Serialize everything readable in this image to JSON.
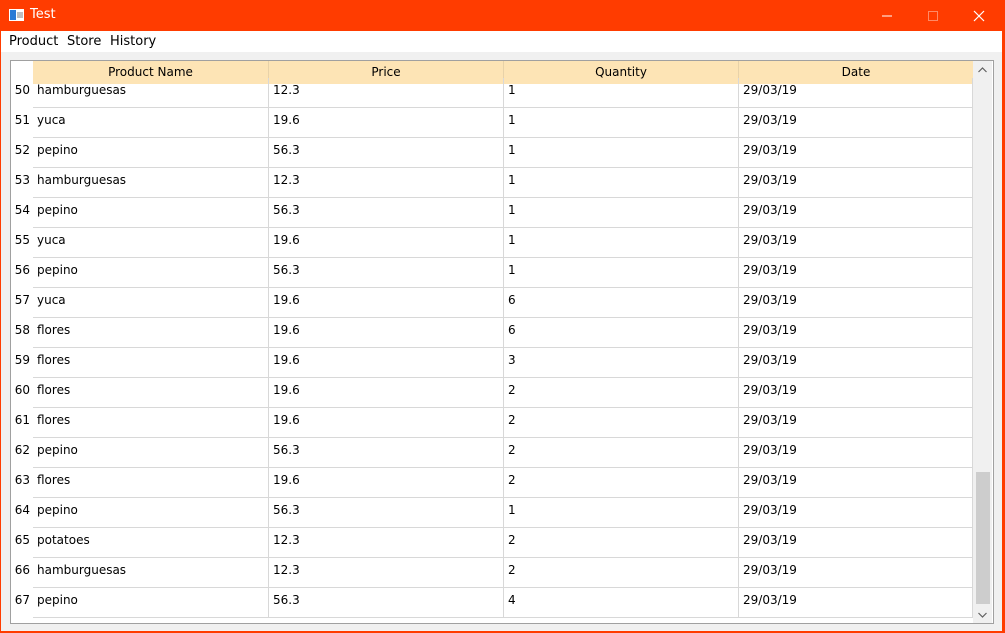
{
  "window": {
    "title": "Test"
  },
  "menu": {
    "items": [
      "Product",
      "Store",
      "History"
    ]
  },
  "table": {
    "columns": [
      "Product Name",
      "Price",
      "Quantity",
      "Date"
    ],
    "rows": [
      {
        "index": "50",
        "cells": [
          "hamburguesas",
          "12.3",
          "1",
          "29/03/19"
        ]
      },
      {
        "index": "51",
        "cells": [
          "yuca",
          "19.6",
          "1",
          "29/03/19"
        ]
      },
      {
        "index": "52",
        "cells": [
          "pepino",
          "56.3",
          "1",
          "29/03/19"
        ]
      },
      {
        "index": "53",
        "cells": [
          "hamburguesas",
          "12.3",
          "1",
          "29/03/19"
        ]
      },
      {
        "index": "54",
        "cells": [
          "pepino",
          "56.3",
          "1",
          "29/03/19"
        ]
      },
      {
        "index": "55",
        "cells": [
          "yuca",
          "19.6",
          "1",
          "29/03/19"
        ]
      },
      {
        "index": "56",
        "cells": [
          "pepino",
          "56.3",
          "1",
          "29/03/19"
        ]
      },
      {
        "index": "57",
        "cells": [
          "yuca",
          "19.6",
          "6",
          "29/03/19"
        ]
      },
      {
        "index": "58",
        "cells": [
          "flores",
          "19.6",
          "6",
          "29/03/19"
        ]
      },
      {
        "index": "59",
        "cells": [
          "flores",
          "19.6",
          "3",
          "29/03/19"
        ]
      },
      {
        "index": "60",
        "cells": [
          "flores",
          "19.6",
          "2",
          "29/03/19"
        ]
      },
      {
        "index": "61",
        "cells": [
          "flores",
          "19.6",
          "2",
          "29/03/19"
        ]
      },
      {
        "index": "62",
        "cells": [
          "pepino",
          "56.3",
          "2",
          "29/03/19"
        ]
      },
      {
        "index": "63",
        "cells": [
          "flores",
          "19.6",
          "2",
          "29/03/19"
        ]
      },
      {
        "index": "64",
        "cells": [
          "pepino",
          "56.3",
          "1",
          "29/03/19"
        ]
      },
      {
        "index": "65",
        "cells": [
          "potatoes",
          "12.3",
          "2",
          "29/03/19"
        ]
      },
      {
        "index": "66",
        "cells": [
          "hamburguesas",
          "12.3",
          "2",
          "29/03/19"
        ]
      },
      {
        "index": "67",
        "cells": [
          "pepino",
          "56.3",
          "4",
          "29/03/19"
        ]
      }
    ]
  },
  "colors": {
    "titlebar": "#ff3c00",
    "header": "#fde4b5",
    "scroll_thumb": "#cdcdcd"
  }
}
